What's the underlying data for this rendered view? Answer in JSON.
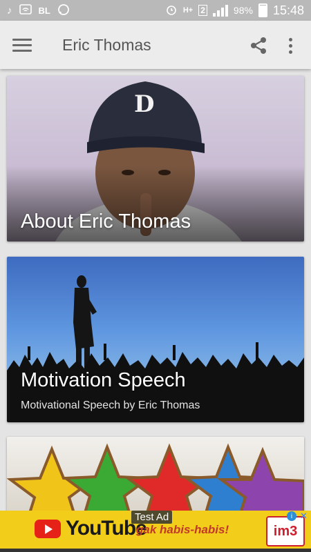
{
  "status_bar": {
    "left_icons": [
      "music-note-icon",
      "wifi-icon",
      "bl-icon",
      "whatsapp-icon"
    ],
    "bl_label": "BL",
    "sim_label": "2",
    "network_label": "H+",
    "battery": "98%",
    "time": "15:48"
  },
  "app_bar": {
    "title": "Eric Thomas"
  },
  "cards": [
    {
      "title": "About Eric Thomas",
      "subtitle": ""
    },
    {
      "title": "Motivation Speech",
      "subtitle": "Motivational Speech by Eric Thomas"
    },
    {
      "title": "",
      "subtitle": ""
    }
  ],
  "ad": {
    "label": "Test Ad",
    "brand": "YouTube",
    "slogan": "gak habis-habis!",
    "sponsor": "im3"
  },
  "colors": {
    "app_bar_bg": "#ececec",
    "status_bar_bg": "#b9b9b9",
    "ad_bg": "#f2cd1a"
  }
}
